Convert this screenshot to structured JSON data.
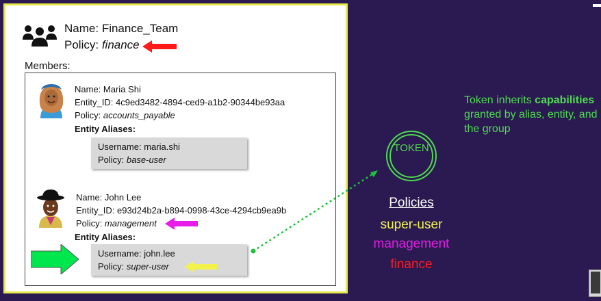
{
  "group": {
    "name_label": "Name:",
    "name_value": "Finance_Team",
    "policy_label": "Policy:",
    "policy_value": "finance",
    "members_label": "Members:"
  },
  "members": [
    {
      "name_label": "Name:",
      "name": "Maria Shi",
      "entity_label": "Entity_ID:",
      "entity_id": "4c9ed3482-4894-ced9-a1b2-90344be93aa",
      "policy_label": "Policy:",
      "policy": "accounts_payable",
      "aliases_label": "Entity Aliases:",
      "alias_username_label": "Username:",
      "alias_username": "maria.shi",
      "alias_policy_label": "Policy:",
      "alias_policy": "base-user"
    },
    {
      "name_label": "Name:",
      "name": "John Lee",
      "entity_label": "Entity_ID:",
      "entity_id": "e93d24b2a-b894-0998-43ce-4294cb9ea9b",
      "policy_label": "Policy:",
      "policy": "management",
      "aliases_label": "Entity Aliases:",
      "alias_username_label": "Username:",
      "alias_username": "john.lee",
      "alias_policy_label": "Policy:",
      "alias_policy": "super-user"
    }
  ],
  "token": {
    "label": "TOKEN",
    "policies_heading": "Policies",
    "policies": [
      {
        "name": "super-user",
        "color": "#f2f24a"
      },
      {
        "name": "management",
        "color": "#e81ce8"
      },
      {
        "name": "finance",
        "color": "#ff1a1a"
      }
    ]
  },
  "note": {
    "prefix": "Token inherits ",
    "bold": "capabilities",
    "suffix": " granted by alias, entity, and the group"
  },
  "colors": {
    "background": "#2b1a52",
    "card_border": "#e8e84a",
    "token_green": "#4cdc4c",
    "arrow_red": "#ff1a1a",
    "arrow_magenta": "#e81ce8",
    "arrow_yellow": "#f2f24a",
    "arrow_green": "#00e64d"
  },
  "icons": [
    "people-group-icon",
    "avatar-woman-hijab",
    "avatar-man-hat"
  ]
}
